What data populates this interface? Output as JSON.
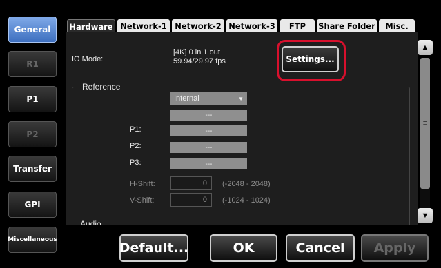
{
  "sidebar": {
    "items": [
      {
        "label": "General",
        "state": "active"
      },
      {
        "label": "R1",
        "state": "disabled"
      },
      {
        "label": "P1",
        "state": "normal"
      },
      {
        "label": "P2",
        "state": "disabled"
      },
      {
        "label": "Transfer",
        "state": "normal"
      },
      {
        "label": "GPI",
        "state": "normal"
      },
      {
        "label": "Miscellaneous",
        "state": "normal"
      }
    ]
  },
  "tabs": [
    "Hardware",
    "Network-1",
    "Network-2",
    "Network-3",
    "FTP",
    "Share Folder",
    "Misc."
  ],
  "active_tab": "Hardware",
  "hardware": {
    "io_mode_label": "IO Mode:",
    "io_mode_value_line1": "[4K] 0 in 1 out",
    "io_mode_value_line2": "59.94/29.97 fps",
    "settings_button": "Settings...",
    "reference": {
      "title": "Reference",
      "source": "Internal",
      "status": "---",
      "p1_label": "P1:",
      "p1_value": "---",
      "p2_label": "P2:",
      "p2_value": "---",
      "p3_label": "P3:",
      "p3_value": "---",
      "hshift_label": "H-Shift:",
      "hshift_value": "0",
      "hshift_range": "(-2048 - 2048)",
      "vshift_label": "V-Shift:",
      "vshift_value": "0",
      "vshift_range": "(-1024 - 1024)"
    },
    "audio_title": "Audio"
  },
  "buttons": {
    "default": "Default...",
    "ok": "OK",
    "cancel": "Cancel",
    "apply": "Apply"
  },
  "colors": {
    "active_accent": "#5b8bd6",
    "highlight_ring": "#d8102d"
  }
}
